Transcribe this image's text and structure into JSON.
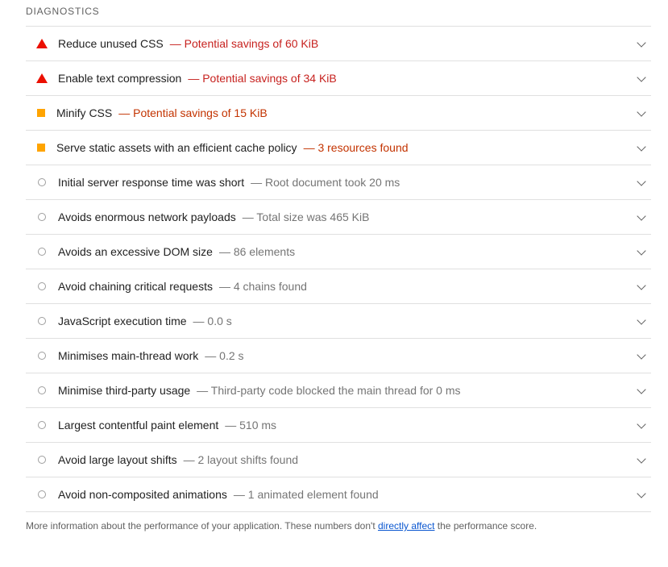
{
  "section": {
    "title": "DIAGNOSTICS"
  },
  "colors": {
    "fail": "#eb0f00",
    "fail_text": "#c7221f",
    "average": "#ffa400",
    "average_text": "#c33300",
    "pass": "#9e9e9e",
    "link": "#0b57d0"
  },
  "audits": [
    {
      "status": "fail",
      "icon": "fail-triangle-icon",
      "title": "Reduce unused CSS",
      "display": "— Potential savings of 60 KiB"
    },
    {
      "status": "fail",
      "icon": "fail-triangle-icon",
      "title": "Enable text compression",
      "display": "— Potential savings of 34 KiB"
    },
    {
      "status": "average",
      "icon": "average-square-icon",
      "title": "Minify CSS",
      "display": "— Potential savings of 15 KiB"
    },
    {
      "status": "average",
      "icon": "average-square-icon",
      "title": "Serve static assets with an efficient cache policy",
      "display": "— 3 resources found"
    },
    {
      "status": "pass",
      "icon": "pass-circle-icon",
      "title": "Initial server response time was short",
      "display": "— Root document took 20 ms"
    },
    {
      "status": "pass",
      "icon": "pass-circle-icon",
      "title": "Avoids enormous network payloads",
      "display": "— Total size was 465 KiB"
    },
    {
      "status": "pass",
      "icon": "pass-circle-icon",
      "title": "Avoids an excessive DOM size",
      "display": "— 86 elements"
    },
    {
      "status": "pass",
      "icon": "pass-circle-icon",
      "title": "Avoid chaining critical requests",
      "display": "— 4 chains found"
    },
    {
      "status": "pass",
      "icon": "pass-circle-icon",
      "title": "JavaScript execution time",
      "display": "— 0.0 s"
    },
    {
      "status": "pass",
      "icon": "pass-circle-icon",
      "title": "Minimises main-thread work",
      "display": "— 0.2 s"
    },
    {
      "status": "pass",
      "icon": "pass-circle-icon",
      "title": "Minimise third-party usage",
      "display": "— Third-party code blocked the main thread for 0 ms"
    },
    {
      "status": "pass",
      "icon": "pass-circle-icon",
      "title": "Largest contentful paint element",
      "display": "— 510 ms"
    },
    {
      "status": "pass",
      "icon": "pass-circle-icon",
      "title": "Avoid large layout shifts",
      "display": "— 2 layout shifts found"
    },
    {
      "status": "pass",
      "icon": "pass-circle-icon",
      "title": "Avoid non-composited animations",
      "display": "— 1 animated element found"
    }
  ],
  "footer": {
    "before": "More information about the performance of your application. These numbers don't ",
    "link": "directly affect",
    "after": " the performance score."
  }
}
